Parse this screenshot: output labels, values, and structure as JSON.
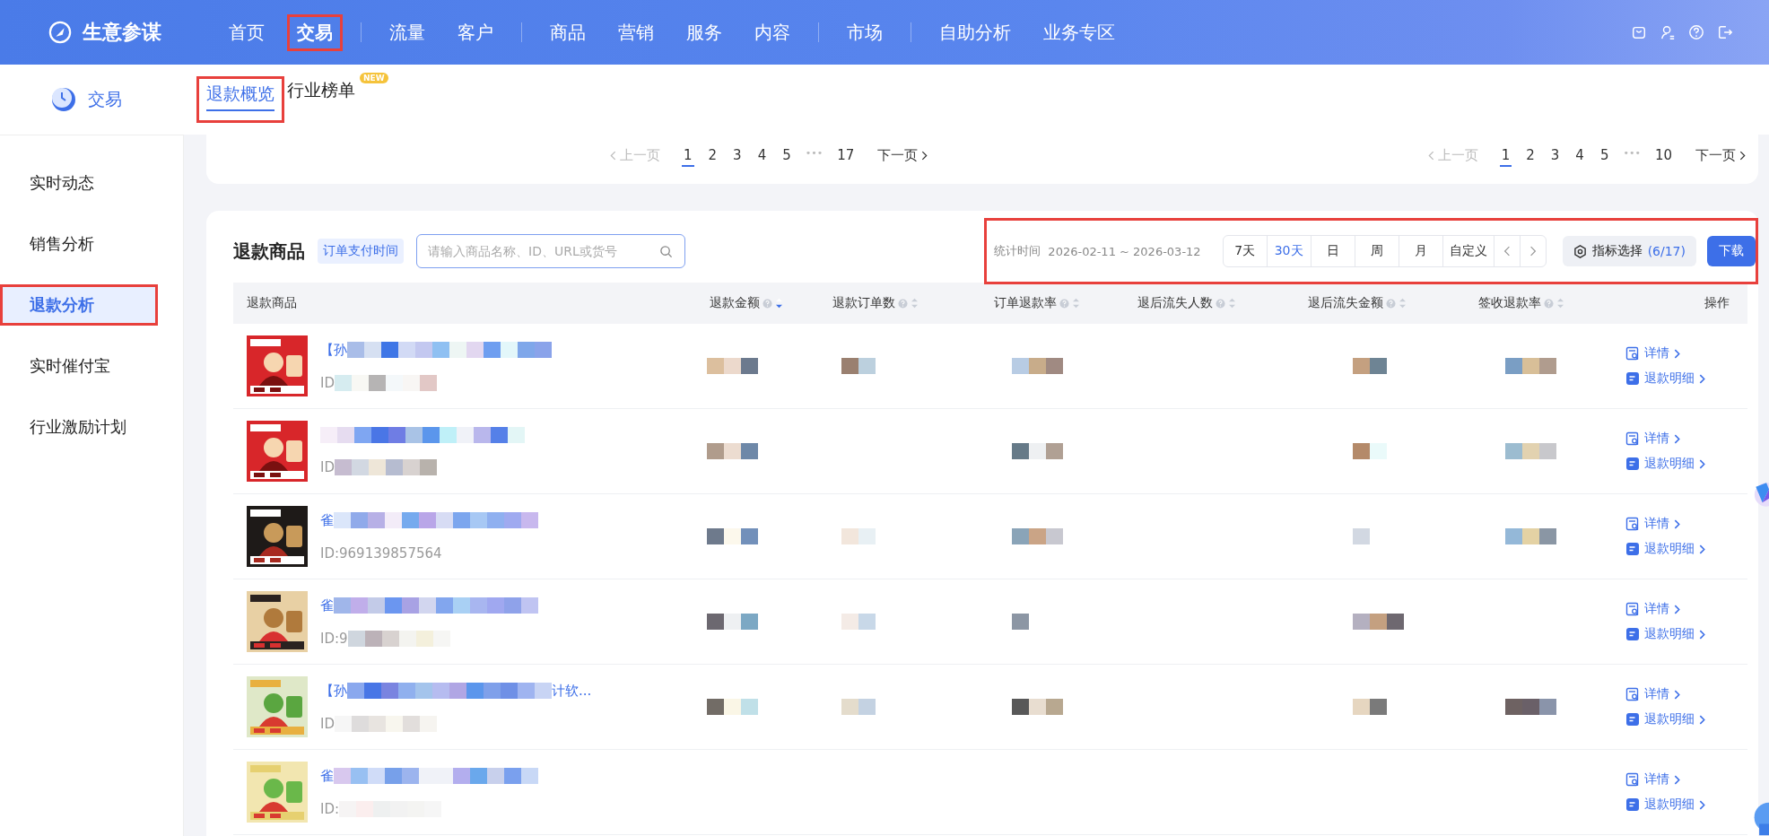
{
  "app": {
    "name": "生意参谋"
  },
  "nav": [
    {
      "label": "首页",
      "selected": false,
      "highlighted": false,
      "separator_before": false
    },
    {
      "label": "交易",
      "selected": true,
      "highlighted": true,
      "separator_before": false
    },
    {
      "label": "流量",
      "selected": false,
      "highlighted": false,
      "separator_before": true
    },
    {
      "label": "客户",
      "selected": false,
      "highlighted": false,
      "separator_before": false
    },
    {
      "label": "商品",
      "selected": false,
      "highlighted": false,
      "separator_before": true
    },
    {
      "label": "营销",
      "selected": false,
      "highlighted": false,
      "separator_before": false
    },
    {
      "label": "服务",
      "selected": false,
      "highlighted": false,
      "separator_before": false
    },
    {
      "label": "内容",
      "selected": false,
      "highlighted": false,
      "separator_before": false
    },
    {
      "label": "市场",
      "selected": false,
      "highlighted": false,
      "separator_before": true
    },
    {
      "label": "自助分析",
      "selected": false,
      "highlighted": false,
      "separator_before": true
    },
    {
      "label": "业务专区",
      "selected": false,
      "highlighted": false,
      "separator_before": false
    }
  ],
  "section": {
    "title": "交易"
  },
  "subtabs": [
    {
      "label": "退款概览",
      "selected": true,
      "highlighted": true
    },
    {
      "label": "行业榜单",
      "selected": false,
      "highlighted": false,
      "badge": "NEW"
    }
  ],
  "sidebar": {
    "items": [
      {
        "label": "实时动态",
        "selected": false,
        "highlighted": false
      },
      {
        "label": "销售分析",
        "selected": false,
        "highlighted": false
      },
      {
        "label": "退款分析",
        "selected": true,
        "highlighted": true
      },
      {
        "label": "实时催付宝",
        "selected": false,
        "highlighted": false
      },
      {
        "label": "行业激励计划",
        "selected": false,
        "highlighted": false
      }
    ]
  },
  "paginations": [
    {
      "prev": "上一页",
      "next": "下一页",
      "ellipsis": "•••",
      "pages": [
        {
          "label": "1",
          "selected": true
        },
        {
          "label": "2",
          "selected": false
        },
        {
          "label": "3",
          "selected": false
        },
        {
          "label": "4",
          "selected": false
        },
        {
          "label": "5",
          "selected": false
        }
      ],
      "last": "17"
    },
    {
      "prev": "上一页",
      "next": "下一页",
      "ellipsis": "•••",
      "pages": [
        {
          "label": "1",
          "selected": true
        },
        {
          "label": "2",
          "selected": false
        },
        {
          "label": "3",
          "selected": false
        },
        {
          "label": "4",
          "selected": false
        },
        {
          "label": "5",
          "selected": false
        }
      ],
      "last": "10"
    }
  ],
  "refund_products": {
    "title": "退款商品",
    "time_tag": "订单支付时间",
    "search": {
      "placeholder": "请输入商品名称、ID、URL或货号"
    },
    "toolbar_highlighted": true,
    "stat_time_label": "统计时间",
    "stat_time_range": "2026-02-11 ~ 2026-03-12",
    "ranges": [
      {
        "label": "7天",
        "selected": false
      },
      {
        "label": "30天",
        "selected": true
      },
      {
        "label": "日",
        "selected": false
      },
      {
        "label": "周",
        "selected": false
      },
      {
        "label": "月",
        "selected": false
      },
      {
        "label": "自定义",
        "selected": false
      }
    ],
    "metric_button": {
      "label": "指标选择",
      "count": "(6/17)"
    },
    "download_button": "下载",
    "columns": [
      {
        "label": "退款商品",
        "kind": "plain"
      },
      {
        "label": "退款金额",
        "kind": "sortable",
        "sorted_desc": true
      },
      {
        "label": "退款订单数",
        "kind": "sortable",
        "sorted_desc": false
      },
      {
        "label": "订单退款率",
        "kind": "sortable",
        "sorted_desc": false
      },
      {
        "label": "退后流失人数",
        "kind": "sortable",
        "sorted_desc": false
      },
      {
        "label": "退后流失金额",
        "kind": "sortable",
        "sorted_desc": false
      },
      {
        "label": "签收退款率",
        "kind": "sortable",
        "sorted_desc": false
      },
      {
        "label": "操作",
        "kind": "action"
      }
    ],
    "rows": [
      {
        "title": "【孙",
        "id": "ID",
        "detail": "详情",
        "refund_detail": "退款明细"
      },
      {
        "id": "ID",
        "detail": "详情",
        "refund_detail": "退款明细"
      },
      {
        "title": "雀",
        "id": "ID:969139857564",
        "detail": "详情",
        "refund_detail": "退款明细"
      },
      {
        "title": "雀",
        "id": "ID:9",
        "detail": "详情",
        "refund_detail": "退款明细"
      },
      {
        "title": "【孙",
        "title_tail": "计软...",
        "id": "ID",
        "detail": "详情",
        "refund_detail": "退款明细"
      },
      {
        "title": "雀",
        "id": "ID:",
        "detail": "详情",
        "refund_detail": "退款明细"
      }
    ]
  }
}
